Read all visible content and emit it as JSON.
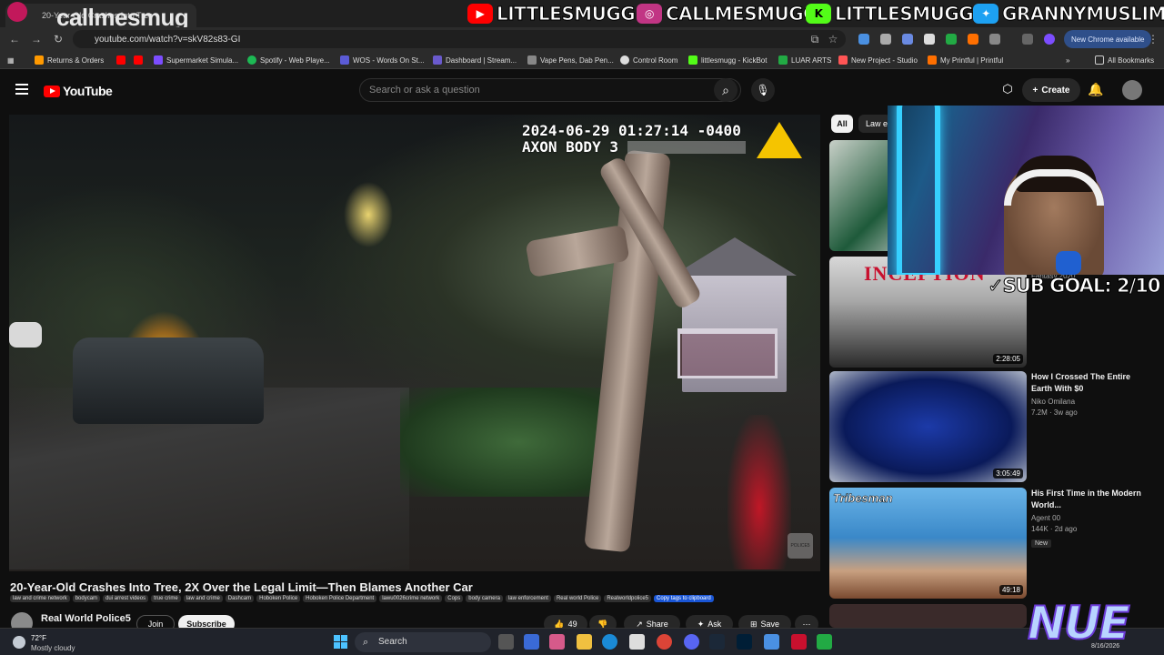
{
  "browser": {
    "tab_title": "20-Year-Old Crashes Into Tree",
    "url": "youtube.com/watch?v=skV82s83-GI",
    "new_chrome_label": "New Chrome available",
    "bookmarks": [
      {
        "label": "Returns & Orders",
        "color": "#ff9900"
      },
      {
        "label": "",
        "color": "#ff0000"
      },
      {
        "label": "",
        "color": "#ff0000"
      },
      {
        "label": "Supermarket Simula...",
        "color": "#7c4dff"
      },
      {
        "label": "Spotify - Web Playe...",
        "color": "#1db954"
      },
      {
        "label": "WOS - Words On St...",
        "color": "#5b5bd6"
      },
      {
        "label": "Dashboard | Stream...",
        "color": "#6a5acd"
      },
      {
        "label": "Vape Pens, Dab Pen...",
        "color": "#888888"
      },
      {
        "label": "Control Room",
        "color": "#dddddd"
      },
      {
        "label": "littlesmugg - KickBot",
        "color": "#53fc18"
      },
      {
        "label": "LUAR ARTS",
        "color": "#22aa44"
      },
      {
        "label": "New Project - Studio",
        "color": "#ff5555"
      },
      {
        "label": "My Printful | Printful",
        "color": "#ff6f00"
      }
    ],
    "all_bookmarks_label": "All Bookmarks"
  },
  "stream_overlay": {
    "channel_name": "callmesmug",
    "socials": [
      {
        "handle": "LITTLESMUGG",
        "color": "#ff0000",
        "glyph": "▶"
      },
      {
        "handle": "CALLMESMUGG",
        "color": "#c13584",
        "glyph": "◎"
      },
      {
        "handle": "LITTLESMUGG",
        "color": "#53fc18",
        "glyph": "K"
      },
      {
        "handle": "GRANNYMUSLIM",
        "color": "#1da1f2",
        "glyph": "✦"
      }
    ],
    "sub_goal": "SUB GOAL: 2/10",
    "brand": "NUE"
  },
  "youtube": {
    "logo_text": "YouTube",
    "search_placeholder": "Search or ask a question",
    "create_label": "Create",
    "video": {
      "timestamp_line1": "2024-06-29 01:27:14 -0400",
      "timestamp_line2": "AXON BODY 3",
      "watermark": "POLICE5",
      "title": "20-Year-Old Crashes Into Tree, 2X Over the Legal Limit—Then Blames Another Car",
      "tags": [
        "law and crime network",
        "bodycam",
        "dui arrest videos",
        "true crime",
        "law and crime",
        "Dashcam",
        "Hoboken Police",
        "Hoboken Police Department",
        "lawu0026crime network",
        "Cops",
        "body camera",
        "law enforcement",
        "Real world Police",
        "Realworldpolice5"
      ],
      "copy_tags_label": "Copy tags to clipboard",
      "channel": "Real World Police5",
      "join_label": "Join",
      "subscribe_label": "Subscribe",
      "like_count": "49",
      "share_label": "Share",
      "ask_label": "Ask",
      "save_label": "Save"
    },
    "chips": [
      "All",
      "Law e"
    ],
    "sidebar": [
      {
        "title": "",
        "channel": "",
        "meta": "",
        "duration": "",
        "badge": ""
      },
      {
        "title": "",
        "channel": "Fantasy 2020",
        "meta": "",
        "duration": "2:28:05",
        "badge": "",
        "thumb_text": "INCEPTION"
      },
      {
        "title": "How I Crossed The Entire Earth With $0",
        "channel": "Niko Omilana",
        "meta": "7.2M · 3w ago",
        "duration": "3:05:49",
        "badge": ""
      },
      {
        "title": "His First Time in the Modern World...",
        "channel": "Agent 00",
        "meta": "144K · 2d ago",
        "duration": "49:18",
        "badge": "New",
        "thumb_text": "Tribesman"
      }
    ]
  },
  "taskbar": {
    "temp": "72°F",
    "condition": "Mostly cloudy",
    "search_label": "Search",
    "date": "8/16/2026"
  }
}
